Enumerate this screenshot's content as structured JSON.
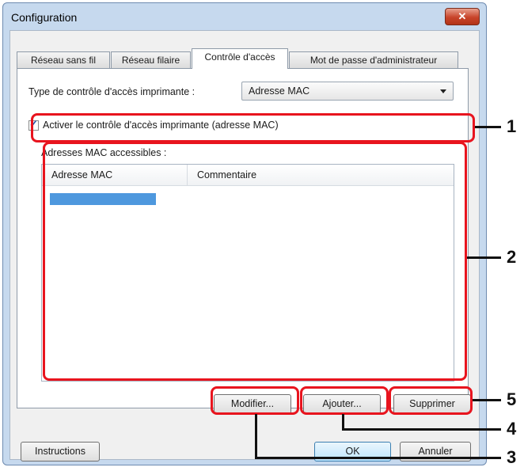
{
  "window": {
    "title": "Configuration",
    "close_icon": "close-icon"
  },
  "tabs": [
    {
      "label": "Réseau sans fil"
    },
    {
      "label": "Réseau filaire"
    },
    {
      "label": "Contrôle d'accès"
    },
    {
      "label": "Mot de passe d'administrateur"
    }
  ],
  "access_type": {
    "label": "Type de contrôle d'accès imprimante :",
    "value": "Adresse MAC"
  },
  "enable_checkbox": {
    "label": "Activer le contrôle d'accès imprimante (adresse MAC)",
    "checked": true
  },
  "mac_list": {
    "label": "Adresses MAC accessibles :",
    "columns": [
      "Adresse MAC",
      "Commentaire"
    ]
  },
  "buttons": {
    "modify": "Modifier...",
    "add": "Ajouter...",
    "delete": "Supprimer",
    "instructions": "Instructions",
    "ok": "OK",
    "cancel": "Annuler"
  },
  "callouts": [
    "1",
    "2",
    "3",
    "4",
    "5"
  ],
  "colors": {
    "highlight": "#e8141e",
    "selection": "#4e98de"
  }
}
